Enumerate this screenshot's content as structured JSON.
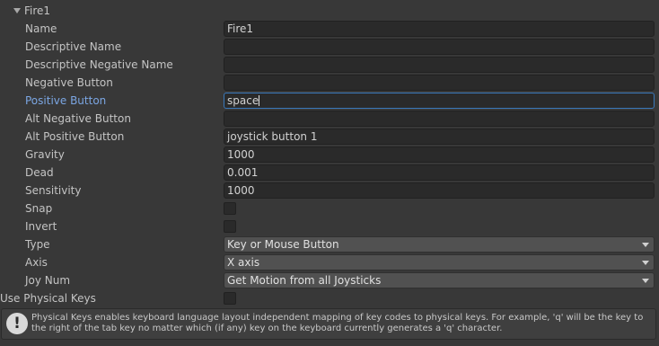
{
  "foldout": {
    "title": "Fire1"
  },
  "fields": {
    "name": {
      "label": "Name",
      "value": "Fire1"
    },
    "descriptive_name": {
      "label": "Descriptive Name",
      "value": ""
    },
    "descriptive_negative_name": {
      "label": "Descriptive Negative Name",
      "value": ""
    },
    "negative_button": {
      "label": "Negative Button",
      "value": ""
    },
    "positive_button": {
      "label": "Positive Button",
      "value": "space"
    },
    "alt_negative_button": {
      "label": "Alt Negative Button",
      "value": ""
    },
    "alt_positive_button": {
      "label": "Alt Positive Button",
      "value": "joystick button 1"
    },
    "gravity": {
      "label": "Gravity",
      "value": "1000"
    },
    "dead": {
      "label": "Dead",
      "value": "0.001"
    },
    "sensitivity": {
      "label": "Sensitivity",
      "value": "1000"
    },
    "snap": {
      "label": "Snap",
      "checked": false
    },
    "invert": {
      "label": "Invert",
      "checked": false
    },
    "type": {
      "label": "Type",
      "value": "Key or Mouse Button"
    },
    "axis": {
      "label": "Axis",
      "value": "X axis"
    },
    "joy_num": {
      "label": "Joy Num",
      "value": "Get Motion from all Joysticks"
    },
    "use_physical_keys": {
      "label": "Use Physical Keys",
      "checked": false
    }
  },
  "help": {
    "icon": "exclamation-icon",
    "text": "Physical Keys enables keyboard language layout independent mapping of key codes to physical keys. For example, 'q' will be the key to the right of the tab key no matter which (if any) key on the keyboard currently generates a 'q' character."
  },
  "colors": {
    "background": "#383838",
    "focused_label": "#7ba6e3",
    "active_border": "#3a79bb"
  }
}
